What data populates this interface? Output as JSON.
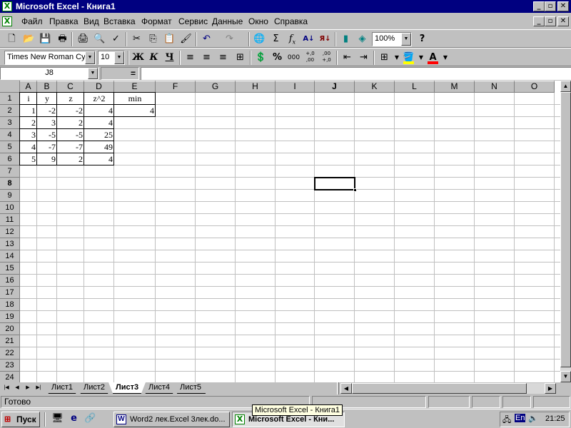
{
  "app": {
    "title": "Microsoft Excel - Книга1",
    "window_buttons": [
      "_",
      "▫",
      "✕"
    ]
  },
  "menu": [
    "Файл",
    "Правка",
    "Вид",
    "Вставка",
    "Формат",
    "Сервис",
    "Данные",
    "Окно",
    "Справка"
  ],
  "toolbar": {
    "zoom": "100%",
    "font_name": "Times New Roman Cyr",
    "font_size": "10",
    "bold": "Ж",
    "italic": "К",
    "underline": "Ч",
    "sigma": "Σ",
    "fx": "f",
    "fx_sub": "x",
    "percent": "%",
    "thousands": "000",
    "inc_dec": "+,0",
    "inc_dec_sub": ",00",
    "dec_dec": ",00",
    "dec_dec_sub": "+,0",
    "sort_asc": "А",
    "sort_desc": "Я",
    "help": "?"
  },
  "formula": {
    "name_box": "J8",
    "equals": "=",
    "value": ""
  },
  "columns": [
    "A",
    "B",
    "C",
    "D",
    "E",
    "F",
    "G",
    "H",
    "I",
    "J",
    "K",
    "L",
    "M",
    "N",
    "O"
  ],
  "rows": [
    "1",
    "2",
    "3",
    "4",
    "5",
    "6",
    "7",
    "8",
    "9",
    "10",
    "11",
    "12",
    "13",
    "14",
    "15",
    "16",
    "17",
    "18",
    "19",
    "20",
    "21",
    "22",
    "23",
    "24"
  ],
  "table": {
    "headers": [
      "i",
      "y",
      "z",
      "z^2",
      "min"
    ],
    "data": [
      [
        "1",
        "-2",
        "-2",
        "4"
      ],
      [
        "2",
        "3",
        "2",
        "4"
      ],
      [
        "3",
        "-5",
        "-5",
        "25"
      ],
      [
        "4",
        "-7",
        "-7",
        "49"
      ],
      [
        "5",
        "9",
        "2",
        "4"
      ]
    ],
    "min_value": "4"
  },
  "sheets": [
    "Лист1",
    "Лист2",
    "Лист3",
    "Лист4",
    "Лист5"
  ],
  "active_sheet": "Лист3",
  "status": "Готово",
  "taskbar": {
    "start": "Пуск",
    "tasks": [
      "Word2 лек.Excel 3лек.do...",
      "Microsoft Excel - Кни..."
    ],
    "tooltip": "Microsoft Excel - Книга1",
    "lang": "En",
    "time": "21:25"
  },
  "colors": {
    "title_bar": "#000080",
    "highlight_fill": "#ffff00",
    "font_color": "#ff0000"
  }
}
